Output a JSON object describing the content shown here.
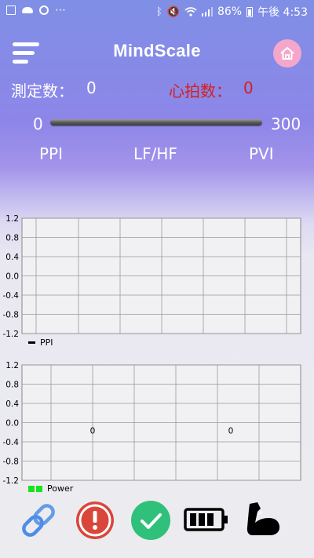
{
  "status_bar": {
    "battery": "86%",
    "time": "午後 4:53"
  },
  "app": {
    "title": "MindScale"
  },
  "stats": {
    "count_label": "測定数：",
    "count_value": "0",
    "hr_label": "心拍数：",
    "hr_value": "0"
  },
  "slider": {
    "min": "0",
    "max": "300"
  },
  "tabs": [
    {
      "label": "PPI"
    },
    {
      "label": "LF/HF"
    },
    {
      "label": "PVI"
    }
  ],
  "chart_data": [
    {
      "type": "line",
      "legend": [
        "PPI"
      ],
      "y_ticks": [
        "1.2",
        "0.8",
        "0.4",
        "0.0",
        "-0.4",
        "-0.8",
        "-1.2"
      ],
      "ylim": [
        -1.2,
        1.2
      ],
      "grid": true,
      "series": [
        {
          "name": "PPI",
          "values": []
        }
      ]
    },
    {
      "type": "bar",
      "legend": [
        "Power"
      ],
      "y_ticks": [
        "1.2",
        "0.8",
        "0.4",
        "0.0",
        "-0.4",
        "-0.8",
        "-1.2"
      ],
      "ylim": [
        -1.2,
        1.2
      ],
      "grid": true,
      "data_labels": [
        "0",
        "0"
      ],
      "series": [
        {
          "name": "Power",
          "values": [
            0,
            0
          ],
          "color": "#17e41b"
        }
      ]
    }
  ],
  "colors": {
    "heart_rate": "#d41f1f",
    "alert": "#d9463a",
    "ok": "#2fc07a",
    "home": "#f4a7cb"
  },
  "bottom_bar": {
    "icons": [
      "link-icon",
      "alert-icon",
      "check-icon",
      "battery-icon",
      "muscle-arm-icon"
    ]
  }
}
